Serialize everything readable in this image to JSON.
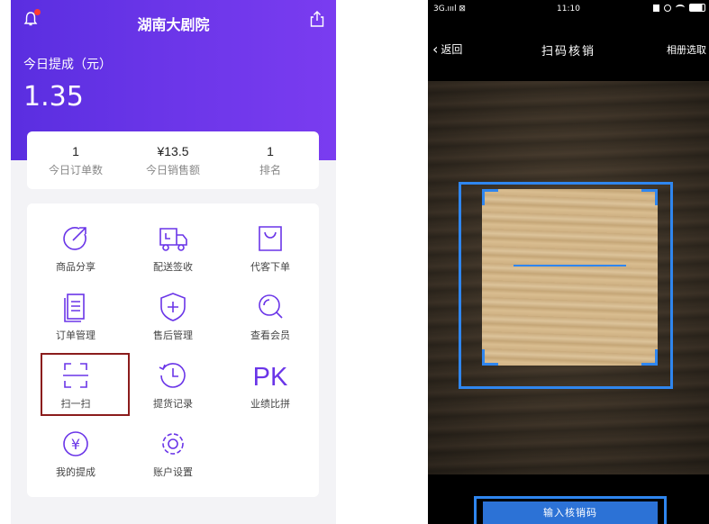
{
  "left_app": {
    "header": {
      "title": "湖南大剧院",
      "notification_icon": "bell-icon",
      "share_icon": "share-icon"
    },
    "earnings": {
      "label": "今日提成（元）",
      "amount": "1.35"
    },
    "stats": [
      {
        "value": "1",
        "label": "今日订单数"
      },
      {
        "value": "¥13.5",
        "label": "今日销售额"
      },
      {
        "value": "1",
        "label": "排名"
      }
    ],
    "menu": [
      {
        "label": "商品分享",
        "icon": "share-arrow-icon"
      },
      {
        "label": "配送签收",
        "icon": "truck-icon"
      },
      {
        "label": "代客下单",
        "icon": "shopping-bag-icon"
      },
      {
        "label": "订单管理",
        "icon": "order-list-icon"
      },
      {
        "label": "售后管理",
        "icon": "shield-plus-icon"
      },
      {
        "label": "查看会员",
        "icon": "search-member-icon"
      },
      {
        "label": "扫一扫",
        "icon": "scan-icon"
      },
      {
        "label": "提货记录",
        "icon": "history-clock-icon"
      },
      {
        "label": "业绩比拼",
        "icon": "pk-icon",
        "icon_text": "PK"
      },
      {
        "label": "我的提成",
        "icon": "yuan-icon",
        "icon_text": "¥"
      },
      {
        "label": "账户设置",
        "icon": "gear-icon"
      }
    ],
    "accent": "#6a35e8",
    "highlight_color": "#8b1c1c"
  },
  "right_app": {
    "status": {
      "left": "3G.ıııl ⊠",
      "time": "11:10"
    },
    "nav": {
      "back_label": "返回",
      "title": "扫码核销",
      "album_label": "相册选取"
    },
    "input_button": "输入核销码",
    "accent": "#2f86ef"
  }
}
